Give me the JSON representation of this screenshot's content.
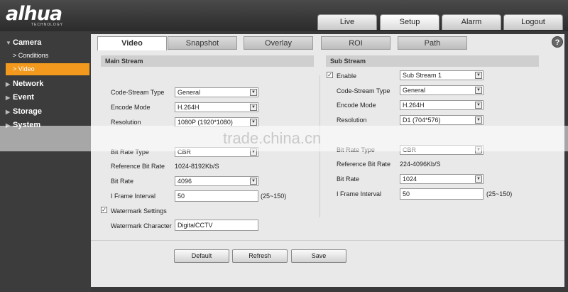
{
  "logo": {
    "brand": "alhua",
    "sub": "TECHNOLOGY"
  },
  "top_tabs": [
    "Live",
    "Setup",
    "Alarm",
    "Logout"
  ],
  "sidebar": {
    "groups": [
      "Camera",
      "Network",
      "Event",
      "Storage",
      "System"
    ],
    "camera_items": [
      "Conditions",
      "Video"
    ]
  },
  "tabs": [
    "Video",
    "Snapshot",
    "Overlay",
    "ROI",
    "Path"
  ],
  "help": "?",
  "main_stream": {
    "title": "Main Stream",
    "code_stream_type": {
      "label": "Code-Stream Type",
      "value": "General"
    },
    "encode_mode": {
      "label": "Encode Mode",
      "value": "H.264H"
    },
    "resolution": {
      "label": "Resolution",
      "value": "1080P (1920*1080)"
    },
    "bit_rate_type": {
      "label": "Bit Rate Type",
      "value": "CBR"
    },
    "reference_bit_rate": {
      "label": "Reference Bit Rate",
      "value": "1024-8192Kb/S"
    },
    "bit_rate": {
      "label": "Bit Rate",
      "value": "4096"
    },
    "i_frame": {
      "label": "I Frame Interval",
      "value": "50",
      "range": "(25~150)"
    },
    "watermark_settings": {
      "label": "Watermark Settings",
      "checked": true
    },
    "watermark_character": {
      "label": "Watermark Character",
      "value": "DigitalCCTV"
    }
  },
  "sub_stream": {
    "title": "Sub Stream",
    "enable": {
      "label": "Enable",
      "checked": true,
      "value": "Sub Stream 1"
    },
    "code_stream_type": {
      "label": "Code-Stream Type",
      "value": "General"
    },
    "encode_mode": {
      "label": "Encode Mode",
      "value": "H.264H"
    },
    "resolution": {
      "label": "Resolution",
      "value": "D1 (704*576)"
    },
    "bit_rate_type": {
      "label": "Bit Rate Type",
      "value": "CBR"
    },
    "reference_bit_rate": {
      "label": "Reference Bit Rate",
      "value": "224-4096Kb/S"
    },
    "bit_rate": {
      "label": "Bit Rate",
      "value": "1024"
    },
    "i_frame": {
      "label": "I Frame Interval",
      "value": "50",
      "range": "(25~150)"
    }
  },
  "buttons": {
    "default": "Default",
    "refresh": "Refresh",
    "save": "Save"
  },
  "watermark_overlay": "trade.china.cn",
  "colors": {
    "accent": "#f39a1e"
  }
}
